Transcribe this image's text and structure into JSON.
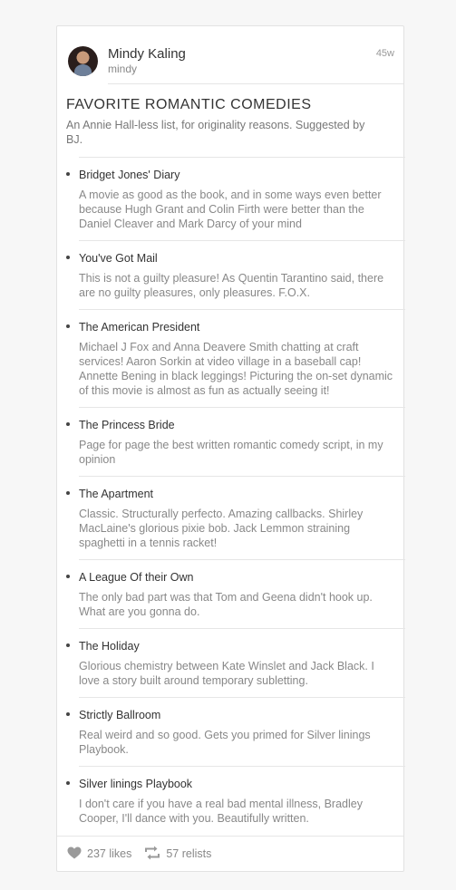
{
  "header": {
    "name": "Mindy Kaling",
    "handle": "mindy",
    "time_ago": "45w"
  },
  "list": {
    "title": "FAVORITE ROMANTIC COMEDIES",
    "description": "An Annie Hall-less list, for originality reasons. Suggested by BJ.",
    "items": [
      {
        "title": "Bridget Jones' Diary",
        "note": "A movie as good as the book, and in some ways even better because Hugh Grant and Colin Firth were better than the Daniel Cleaver and Mark Darcy of your mind"
      },
      {
        "title": "You've Got Mail",
        "note": "This is not a guilty pleasure! As Quentin Tarantino said, there are no guilty pleasures, only pleasures. F.O.X."
      },
      {
        "title": "The American President",
        "note": "Michael J Fox and Anna Deavere Smith chatting at craft services! Aaron Sorkin at video village in a baseball cap! Annette Bening in black leggings! Picturing the on-set dynamic of this movie is almost as fun as actually seeing it!"
      },
      {
        "title": "The Princess Bride",
        "note": "Page for page the best written romantic comedy script, in my opinion"
      },
      {
        "title": "The Apartment",
        "note": "Classic. Structurally perfecto. Amazing callbacks. Shirley MacLaine's glorious pixie bob. Jack Lemmon straining spaghetti in a tennis racket!"
      },
      {
        "title": "A League Of their Own",
        "note": "The only bad part was that Tom and Geena didn't hook up. What are you gonna do."
      },
      {
        "title": "The Holiday",
        "note": "Glorious chemistry between Kate Winslet and Jack Black. I love a story built around temporary subletting."
      },
      {
        "title": "Strictly Ballroom",
        "note": "Real weird and so good. Gets you primed for Silver linings Playbook."
      },
      {
        "title": "Silver linings Playbook",
        "note": "I don't care if you have a real bad mental illness, Bradley Cooper, I'll dance with you. Beautifully written."
      }
    ]
  },
  "footer": {
    "likes": "237 likes",
    "relists": "57 relists",
    "icons": {
      "like": "heart-icon",
      "relist": "relist-icon"
    }
  }
}
